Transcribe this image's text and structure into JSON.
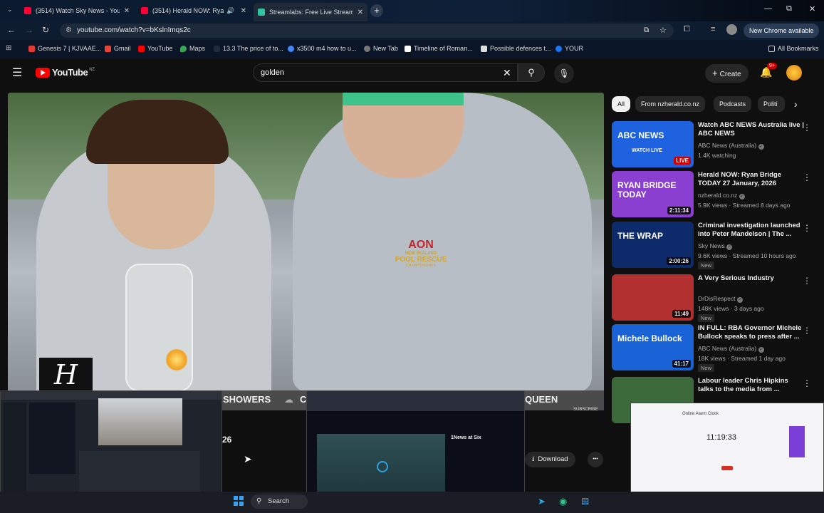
{
  "browser": {
    "tabs": [
      {
        "label": "(3514) Watch Sky News - YouTu",
        "color": "#ff0033"
      },
      {
        "label": "(3514) Herald NOW: Ryan B",
        "color": "#ff0033"
      },
      {
        "label": "Streamlabs: Free Live Streamin",
        "color": "#31c3a2"
      }
    ],
    "new_tab": "+",
    "window_controls": {
      "minimize": "—",
      "restore": "⧉",
      "close": "✕"
    },
    "url": "youtube.com/watch?v=bKslnImqs2c",
    "new_chrome": "New Chrome available",
    "bookmarks": [
      {
        "label": "Genesis 7 | KJVAAE...",
        "color": "#e53935"
      },
      {
        "label": "Gmail",
        "color": "#ea4335"
      },
      {
        "label": "YouTube",
        "color": "#ff0000"
      },
      {
        "label": "Maps",
        "color": "#34a853"
      },
      {
        "label": "13.3 The price of to...",
        "color": "#1e2b3c"
      },
      {
        "label": "x3500 m4 how to u...",
        "color": "#4285f4"
      },
      {
        "label": "New Tab",
        "color": "#777777"
      },
      {
        "label": "Timeline of Roman...",
        "color": "#ffffff"
      },
      {
        "label": "Possible defences t...",
        "color": "#dddddd"
      },
      {
        "label": "YOUR",
        "color": "#1877f2"
      }
    ],
    "bookmarks_folder": "All Bookmarks"
  },
  "youtube": {
    "logo_text": "YouTube",
    "region": "NZ",
    "search_query": "golden",
    "create_label": "Create",
    "notifications": "9+",
    "chips": [
      {
        "label": "All",
        "selected": true
      },
      {
        "label": "From nzherald.co.nz",
        "selected": false
      },
      {
        "label": "Podcasts",
        "selected": false
      },
      {
        "label": "Politi",
        "selected": false
      }
    ],
    "video": {
      "hoodie_brand": "AON",
      "hoodie_line1": "NEW ZEALAND",
      "hoodie_line2": "POOL RESCUE",
      "hoodie_line3": "CHAMPIONSHIPS",
      "channel_watermark": "H",
      "ticker_left": "SHOWERS",
      "ticker_mid": "C",
      "ticker_right": "QUEEN",
      "subscribe": "SUBSCRIBE",
      "date_fragment": "26",
      "download_label": "Download",
      "more_label": "•••"
    },
    "recommendations": [
      {
        "title": "Watch ABC NEWS Australia live | ABC NEWS",
        "channel": "ABC News (Australia)",
        "meta": "1.4K watching",
        "badge": "LIVE",
        "duration": "",
        "new": "",
        "thumb_text": "ABC NEWS",
        "thumb_sub": "WATCH LIVE",
        "thumb_color": "#1e62e0"
      },
      {
        "title": "Herald NOW: Ryan Bridge TODAY 27 January, 2026",
        "channel": "nzherald.co.nz",
        "meta": "5.9K views · Streamed 8 days ago",
        "badge": "",
        "duration": "2:11:34",
        "new": "",
        "thumb_text": "RYAN BRIDGE TODAY",
        "thumb_sub": "",
        "thumb_color": "#8a3fd0"
      },
      {
        "title": "Criminal investigation launched into Peter Mandelson | The ...",
        "channel": "Sky News",
        "meta": "9.6K views · Streamed 10 hours ago",
        "badge": "",
        "duration": "2:00:26",
        "new": "New",
        "thumb_text": "THE WRAP",
        "thumb_sub": "",
        "thumb_color": "#0d2a6b"
      },
      {
        "title": "A Very Serious Industry",
        "channel": "DrDisRespect",
        "meta": "148K views · 3 days ago",
        "badge": "",
        "duration": "11:49",
        "new": "New",
        "thumb_text": "",
        "thumb_sub": "",
        "thumb_color": "#b23030"
      },
      {
        "title": "IN FULL: RBA Governor Michele Bullock speaks to press after ...",
        "channel": "ABC News (Australia)",
        "meta": "18K views · Streamed 1 day ago",
        "badge": "",
        "duration": "41:17",
        "new": "New",
        "thumb_text": "Michele Bullock",
        "thumb_sub": "",
        "thumb_color": "#1a63d6"
      },
      {
        "title": "Labour leader Chris Hipkins talks to the media from ...",
        "channel": "",
        "meta": "",
        "badge": "",
        "duration": "",
        "new": "",
        "thumb_text": "",
        "thumb_sub": "",
        "thumb_color": "#3d6a3a"
      }
    ]
  },
  "overlay": {
    "clock_time": "11:19:33",
    "clock_title": "Online Alarm Clock",
    "news_title": "1News at Six"
  },
  "taskbar": {
    "search_placeholder": "Search"
  }
}
